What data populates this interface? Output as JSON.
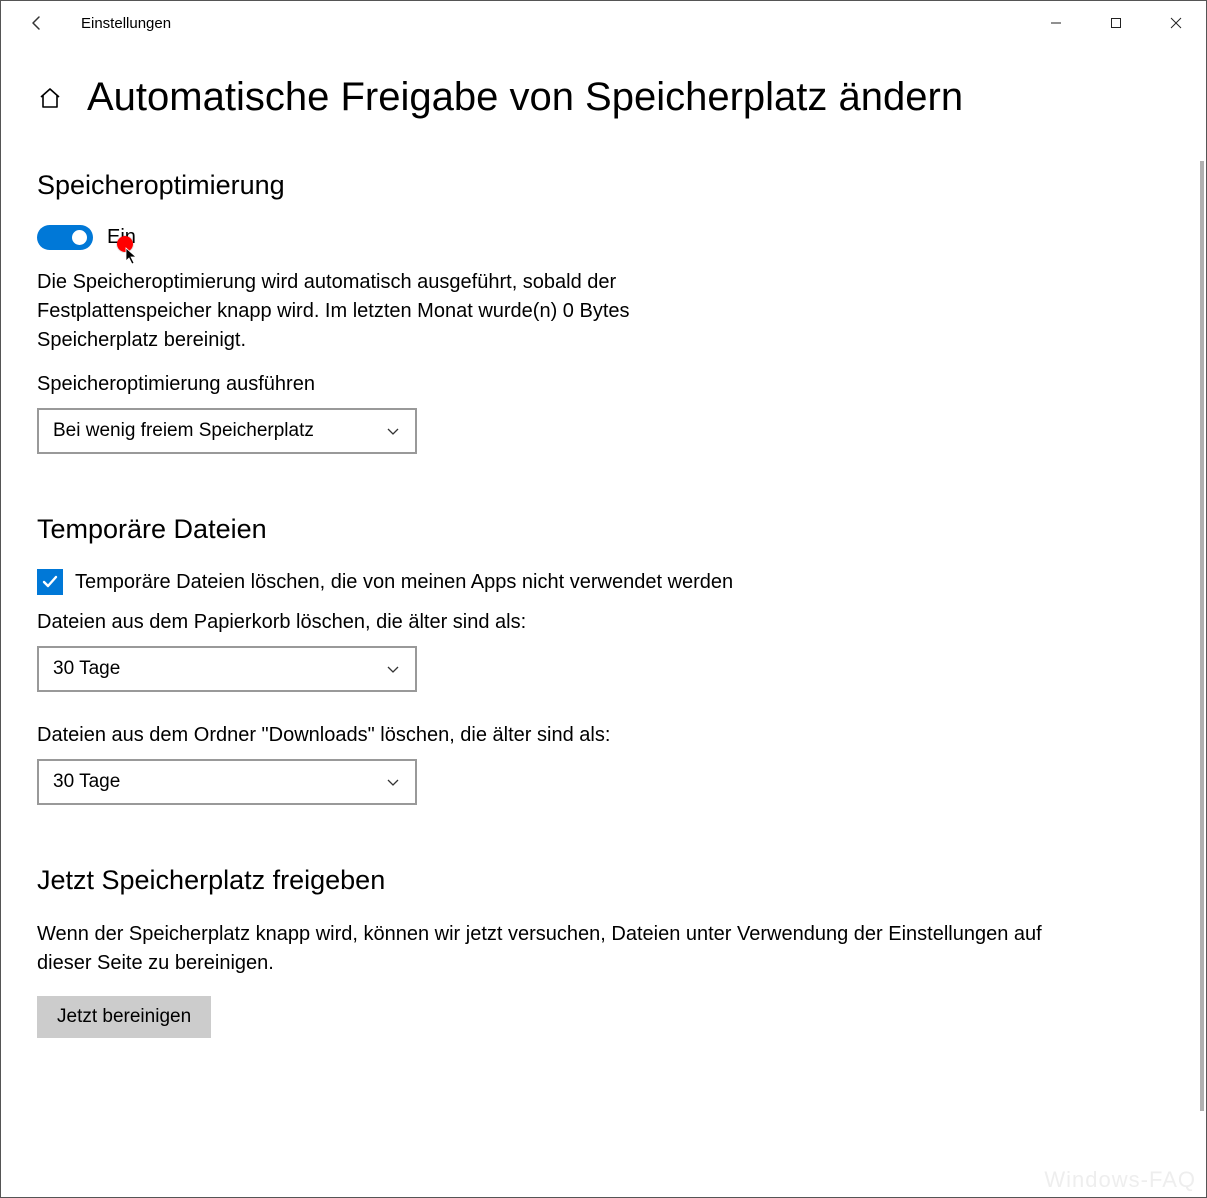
{
  "window": {
    "title": "Einstellungen"
  },
  "page": {
    "title": "Automatische Freigabe von Speicherplatz ändern"
  },
  "storage_sense": {
    "heading": "Speicheroptimierung",
    "toggle_state": "Ein",
    "description": "Die Speicheroptimierung wird automatisch ausgeführt, sobald der Festplattenspeicher knapp wird. Im letzten Monat wurde(n) 0 Bytes Speicherplatz bereinigt.",
    "run_label": "Speicheroptimierung ausführen",
    "run_value": "Bei wenig freiem Speicherplatz"
  },
  "temp_files": {
    "heading": "Temporäre Dateien",
    "checkbox_label": "Temporäre Dateien löschen, die von meinen Apps nicht verwendet werden",
    "recycle_label": "Dateien aus dem Papierkorb löschen, die älter sind als:",
    "recycle_value": "30 Tage",
    "downloads_label": "Dateien aus dem Ordner \"Downloads\" löschen, die älter sind als:",
    "downloads_value": "30 Tage"
  },
  "free_now": {
    "heading": "Jetzt Speicherplatz freigeben",
    "description": "Wenn der Speicherplatz knapp wird, können wir jetzt versuchen, Dateien unter Verwendung der Einstellungen auf dieser Seite zu bereinigen.",
    "button": "Jetzt bereinigen"
  },
  "watermark": "Windows-FAQ"
}
